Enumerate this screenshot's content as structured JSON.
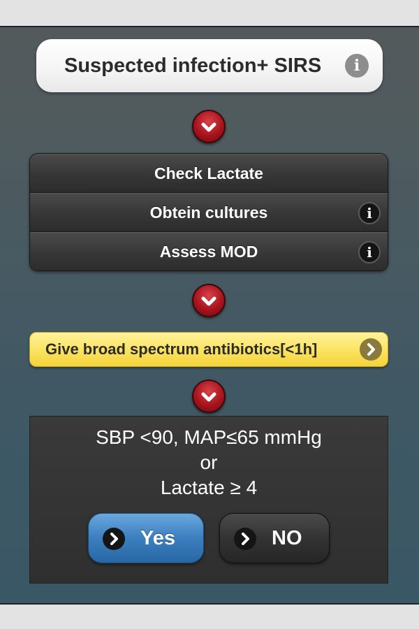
{
  "top_pill": {
    "title": "Suspected infection+ SIRS",
    "info_icon": "i"
  },
  "steps": [
    {
      "label": "Check Lactate",
      "has_info": false
    },
    {
      "label": "Obtein cultures",
      "has_info": true,
      "info_icon": "i"
    },
    {
      "label": "Assess MOD",
      "has_info": true,
      "info_icon": "i"
    }
  ],
  "antibiotics_button": {
    "label": "Give broad spectrum antibiotics[<1h]"
  },
  "question_panel": {
    "line1": "SBP <90, MAP≤65 mmHg",
    "line2": "or",
    "line3": "Lactate ≥ 4",
    "yes_label": "Yes",
    "no_label": "NO"
  },
  "colors": {
    "background": "#e3e3e3",
    "screen_gradient_top": "#545a5c",
    "screen_gradient_bottom": "#3a5765",
    "chevron_red": "#a8141e",
    "yellow": "#fbe463",
    "yes_blue": "#3b7fc0",
    "dark_button": "#333333"
  },
  "icons": {
    "chevron": "chevron-down-icon",
    "info": "info-icon",
    "arrow": "chevron-right-icon"
  }
}
